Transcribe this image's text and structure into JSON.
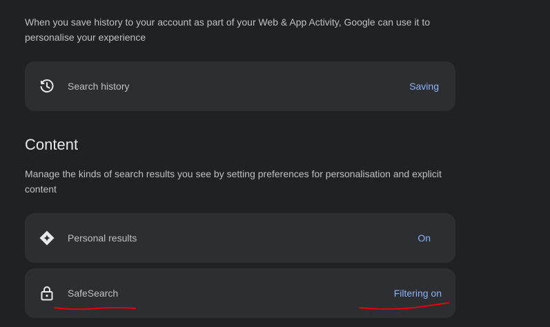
{
  "history_section": {
    "description": "When you save history to your account as part of your Web & App Activity, Google can use it to personalise your experience",
    "search_history": {
      "label": "Search history",
      "value": "Saving",
      "icon": "history-icon"
    }
  },
  "content_section": {
    "title": "Content",
    "description": "Manage the kinds of search results you see by setting preferences for personalisation and explicit content",
    "personal_results": {
      "label": "Personal results",
      "value": "On",
      "icon": "sparkle-diamond-icon"
    },
    "safesearch": {
      "label": "SafeSearch",
      "value": "Filtering on",
      "icon": "lock-icon"
    }
  },
  "colors": {
    "background": "#202124",
    "card": "#2d2e31",
    "accent": "#8ab4f8",
    "annotation": "#e8000b"
  }
}
